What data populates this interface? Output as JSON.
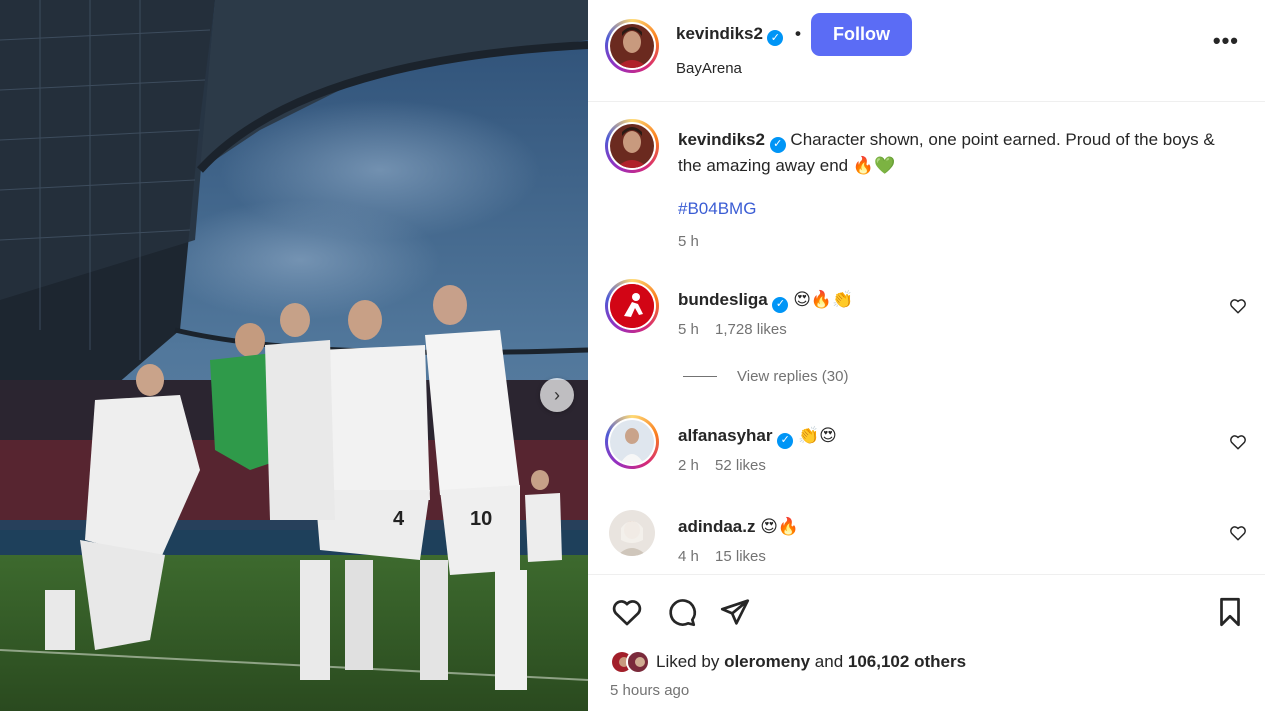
{
  "post": {
    "author": "kevindiks2",
    "verified_mark": "✓",
    "separator": "•",
    "follow_label": "Follow",
    "location": "BayArena",
    "more_label": "•••",
    "carousel_next": "›"
  },
  "caption": {
    "username": "kevindiks2",
    "text": "Character shown, one point earned. Proud of the boys & the amazing away end",
    "emojis": "🔥💚",
    "hashtag": "#B04BMG",
    "time": "5 h"
  },
  "comments": [
    {
      "username": "bundesliga",
      "emojis": "😍🔥👏",
      "time": "5 h",
      "likes": "1,728 likes",
      "replies": "View replies (30)"
    },
    {
      "username": "alfanasyhar",
      "emojis": "👏😍",
      "time": "2 h",
      "likes": "52 likes"
    },
    {
      "username": "adindaa.z",
      "emojis": "😍🔥",
      "time": "4 h",
      "likes": "15 likes"
    }
  ],
  "likes": {
    "prefix": "Liked by",
    "user": "oleromeny",
    "middle": "and",
    "others": "106,102 others"
  },
  "posted_ago": "5 hours ago",
  "colors": {
    "follow_button": "#5b6cf5",
    "verified": "#0095f6",
    "hashtag": "#3b5dd4",
    "bundesliga_red": "#d20515"
  },
  "icons": [
    "like-icon",
    "comment-icon",
    "share-icon",
    "save-icon",
    "heart-icon",
    "more-icon",
    "chevron-right-icon"
  ]
}
